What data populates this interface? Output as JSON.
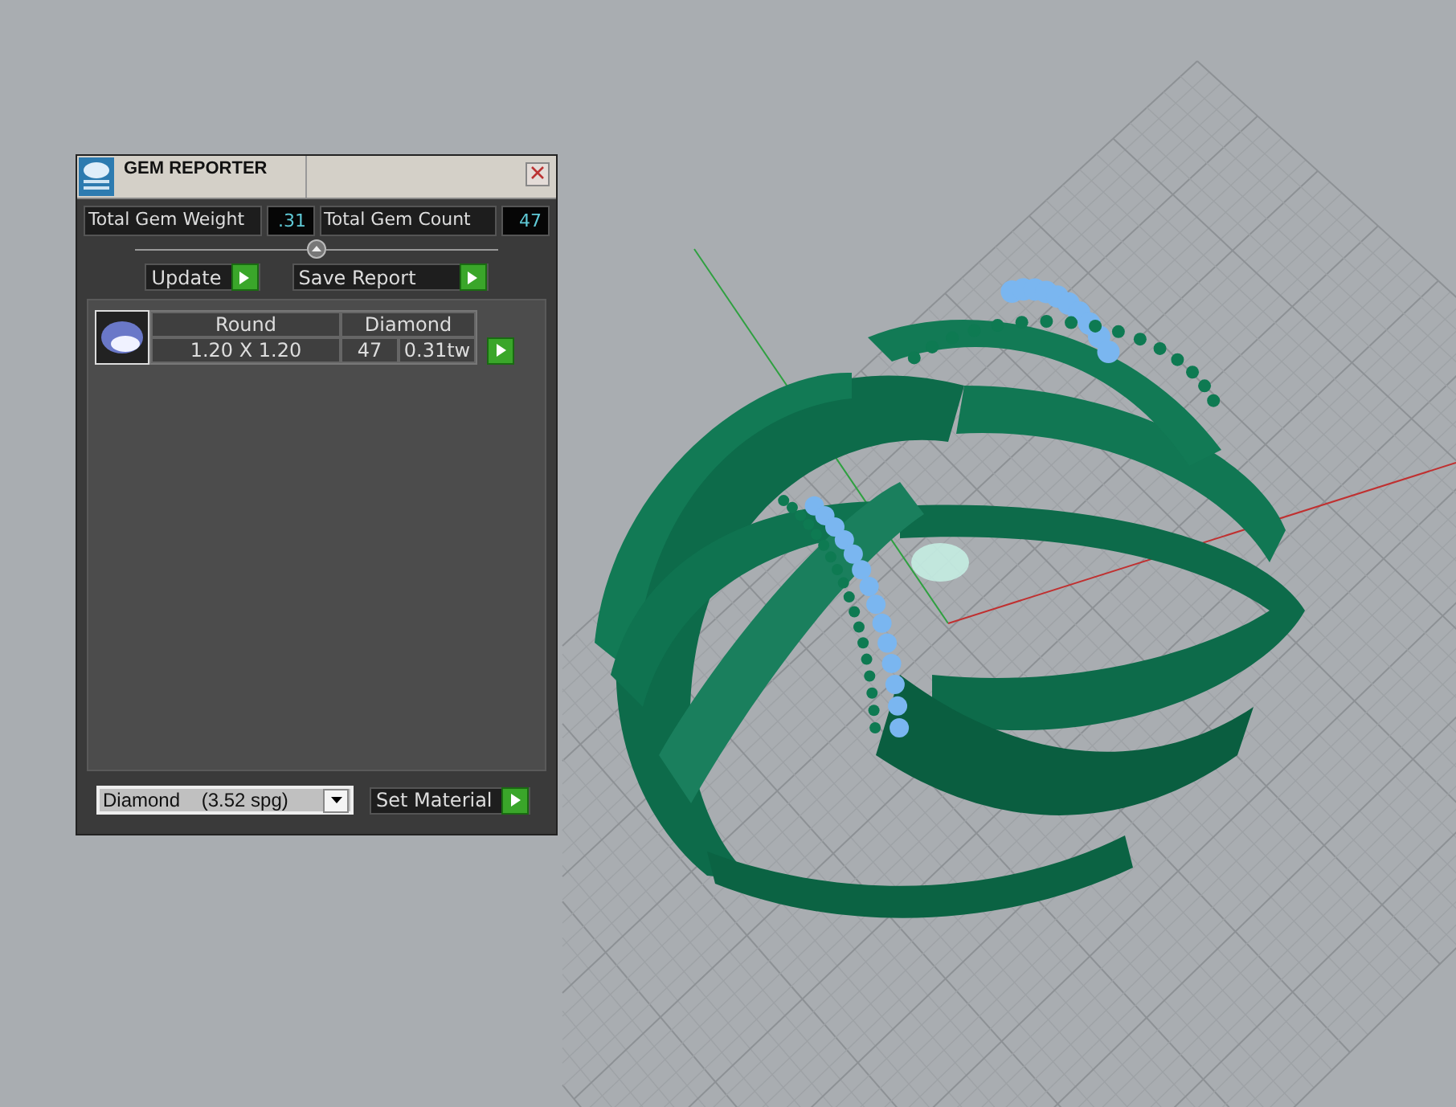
{
  "panel": {
    "title": "GEM REPORTER",
    "totals": [
      {
        "label": "Total Gem Weight",
        "value": ".31"
      },
      {
        "label": "Total Gem Count",
        "value": "47"
      }
    ],
    "buttons": [
      "Update",
      "Save Report"
    ],
    "gems": [
      {
        "shape": "Round",
        "size": "1.20 X 1.20",
        "material": "Diamond",
        "count": "47",
        "weight": "0.31tw"
      }
    ],
    "material_select": {
      "value": "Diamond    (3.52 spg)"
    },
    "set_button": "Set Material"
  }
}
